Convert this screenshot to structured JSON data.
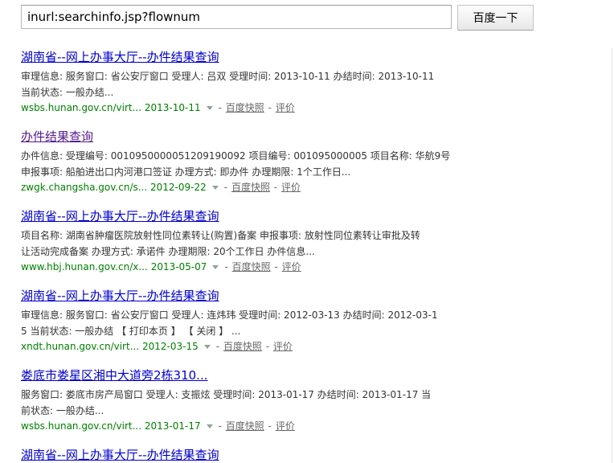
{
  "search": {
    "query": "inurl:searchinfo.jsp?flownum",
    "button_label": "百度一下"
  },
  "results": [
    {
      "title": "湖南省--网上办事大厅--办件结果查询",
      "desc1": "审理信息: 服务窗口: 省公安厅窗口 受理人: 吕双 受理时间: 2013-10-11 办结时间: 2013-10-11",
      "desc2": "当前状态: 一般办结...",
      "url": "wsbs.hunan.gov.cn/virt...",
      "date": "2013-10-11"
    },
    {
      "title": "办件结果查询",
      "desc1": "办件信息: 受理编号: 0010950000051209190092 项目编号: 001095000005 项目名称: 华航9号",
      "desc2": "申报事项: 船舶进出口内河港口签证 办理方式: 即办件 办理期限: 1个工作日...",
      "url": "zwgk.changsha.gov.cn/s...",
      "date": "2012-09-22"
    },
    {
      "title": "湖南省--网上办事大厅--办件结果查询",
      "desc1": "项目名称: 湖南省肿瘤医院放射性同位素转让(购置)备案 申报事项: 放射性同位素转让审批及转",
      "desc2": "让活动完成备案 办理方式: 承诺件 办理期限: 20个工作日 办件信息...",
      "url": "www.hbj.hunan.gov.cn/x...",
      "date": "2013-05-07"
    },
    {
      "title": "湖南省--网上办事大厅--办件结果查询",
      "desc1": "审理信息: 服务窗口: 省公安厅窗口 受理人: 连炜玮 受理时间: 2012-03-13 办结时间: 2012-03-1",
      "desc2": "5 当前状态: 一般办结 【 打印本页 】 【 关闭 】 ...",
      "url": "xndt.hunan.gov.cn/virt...",
      "date": "2012-03-15"
    },
    {
      "title": "娄底市娄星区湘中大道旁2栋310...",
      "desc1": "服务窗口: 娄底市房产局窗口 受理人: 支振炫 受理时间: 2013-01-17 办结时间: 2013-01-17 当",
      "desc2": "前状态: 一般办结...",
      "url": "wsbs.hunan.gov.cn/virt...",
      "date": "2013-01-17"
    },
    {
      "title": "湖南省--网上办事大厅--办件结果查询"
    }
  ],
  "result_links": {
    "snapshot": "百度快照",
    "separator": "-",
    "evaluate": "评价"
  },
  "colors": {
    "title_link": "#0000cc",
    "visited_link": "#551a8b",
    "url_green": "#008000",
    "text": "#333333"
  }
}
